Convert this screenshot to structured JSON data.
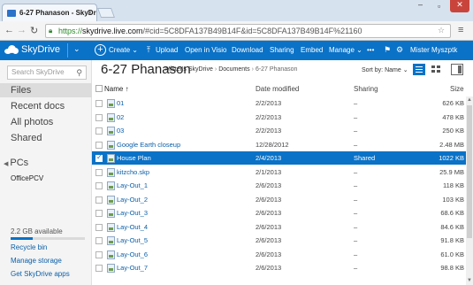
{
  "browser": {
    "tab_title": "6-27 Phanason - SkyDriv",
    "url_scheme": "https://",
    "url_domain": "skydrive.live.com",
    "url_rest": "/#cid=5C8DFA137B49B14F&id=5C8DFA137B49B14F%21160"
  },
  "topbar": {
    "brand": "SkyDrive",
    "create": "Create",
    "upload": "Upload",
    "open_in_visio": "Open in Visio",
    "download": "Download",
    "sharing": "Sharing",
    "embed": "Embed",
    "manage": "Manage",
    "more": "•••",
    "user": "Mister Myszptk"
  },
  "sidebar": {
    "search_placeholder": "Search SkyDrive",
    "nav": [
      "Files",
      "Recent docs",
      "All photos",
      "Shared"
    ],
    "selected_nav": "Files",
    "pcs_label": "PCs",
    "pc_name": "OfficePCV",
    "storage_text": "2.2 GB available",
    "storage_used_fraction": 0.3,
    "links": [
      "Recycle bin",
      "Manage storage",
      "Get SkyDrive apps"
    ]
  },
  "content": {
    "folder_title": "6-27 Phanason",
    "breadcrumb": [
      "Mister's SkyDrive",
      "Documents",
      "6-27 Phanason"
    ],
    "sort_by": "Sort by: Name",
    "columns": {
      "name": "Name",
      "sort_arrow": "↑",
      "date": "Date modified",
      "sharing": "Sharing",
      "size": "Size"
    },
    "files": [
      {
        "name": "01",
        "date": "2/2/2013",
        "sharing": "–",
        "size": "626 KB",
        "icon": "image-icon"
      },
      {
        "name": "02",
        "date": "2/2/2013",
        "sharing": "–",
        "size": "478 KB",
        "icon": "image-icon"
      },
      {
        "name": "03",
        "date": "2/2/2013",
        "sharing": "–",
        "size": "250 KB",
        "icon": "image-icon"
      },
      {
        "name": "Google Earth closeup",
        "date": "12/28/2012",
        "sharing": "–",
        "size": "2.48 MB",
        "icon": "image-icon"
      },
      {
        "name": "House Plan",
        "date": "2/4/2013",
        "sharing": "Shared",
        "size": "1022 KB",
        "icon": "visio-icon",
        "selected": true
      },
      {
        "name": "kitzcho.skp",
        "date": "2/1/2013",
        "sharing": "–",
        "size": "25.9 MB",
        "icon": "file-icon"
      },
      {
        "name": "Lay-Out_1",
        "date": "2/6/2013",
        "sharing": "–",
        "size": "118 KB",
        "icon": "image-icon"
      },
      {
        "name": "Lay-Out_2",
        "date": "2/6/2013",
        "sharing": "–",
        "size": "103 KB",
        "icon": "image-icon"
      },
      {
        "name": "Lay-Out_3",
        "date": "2/6/2013",
        "sharing": "–",
        "size": "68.6 KB",
        "icon": "image-icon"
      },
      {
        "name": "Lay-Out_4",
        "date": "2/6/2013",
        "sharing": "–",
        "size": "84.6 KB",
        "icon": "image-icon"
      },
      {
        "name": "Lay-Out_5",
        "date": "2/6/2013",
        "sharing": "–",
        "size": "91.8 KB",
        "icon": "image-icon"
      },
      {
        "name": "Lay-Out_6",
        "date": "2/6/2013",
        "sharing": "–",
        "size": "61.0 KB",
        "icon": "image-icon"
      },
      {
        "name": "Lay-Out_7",
        "date": "2/6/2013",
        "sharing": "–",
        "size": "98.8 KB",
        "icon": "image-icon"
      }
    ]
  },
  "colors": {
    "accent": "#0a72c7",
    "link": "#0a5fa8",
    "selected_row": "#0a72c7"
  }
}
